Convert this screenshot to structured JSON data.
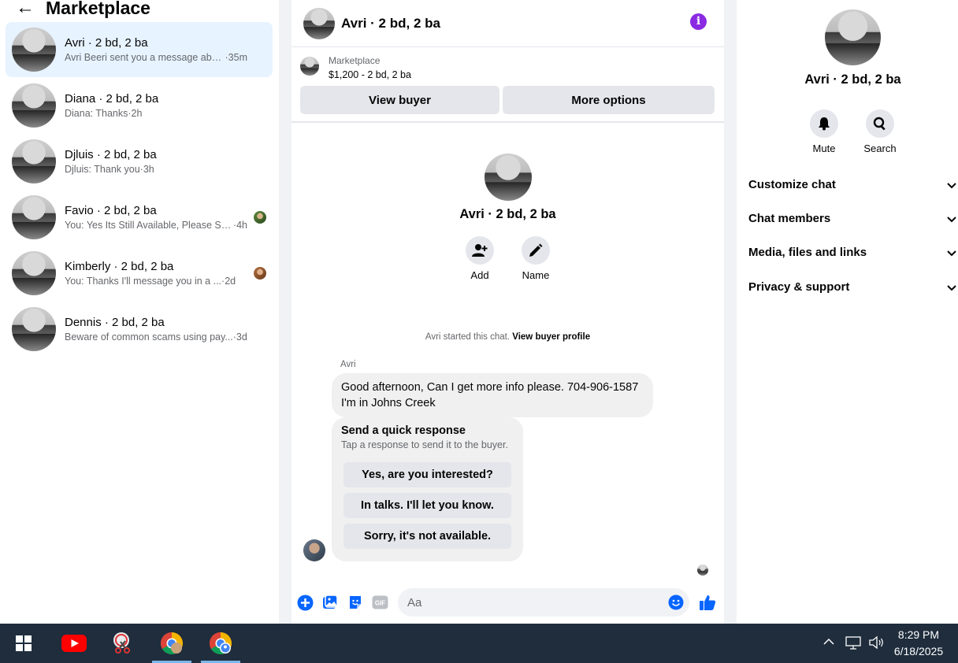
{
  "left": {
    "back_glyph": "←",
    "title": "Marketplace",
    "conversations": [
      {
        "name": "Avri · 2 bd, 2 ba",
        "snippet": "Avri Beeri sent you a message abou...",
        "time": "·35m",
        "active": true
      },
      {
        "name": "Diana · 2 bd, 2 ba",
        "snippet": "Diana: Thanks",
        "time": "·2h"
      },
      {
        "name": "Djluis · 2 bd, 2 ba",
        "snippet": "Djluis: Thank you",
        "time": "·3h"
      },
      {
        "name": "Favio · 2 bd, 2 ba",
        "snippet": "You: Yes Its Still Available, Please Se...",
        "time": "·4h"
      },
      {
        "name": "Kimberly · 2 bd, 2 ba",
        "snippet": "You: Thanks I'll message you in a ...",
        "time": "·2d"
      },
      {
        "name": "Dennis · 2 bd, 2 ba",
        "snippet": "Beware of common scams using pay...",
        "time": "·3d"
      }
    ]
  },
  "chat": {
    "title": "Avri · 2 bd, 2 ba",
    "info_glyph": "i",
    "listing": {
      "source": "Marketplace",
      "price_line": "$1,200 - 2 bd, 2 ba",
      "view_buyer_label": "View buyer",
      "more_options_label": "More options"
    },
    "profile": {
      "name": "Avri · 2 bd, 2 ba",
      "add_label": "Add",
      "name_label": "Name"
    },
    "started_text": "Avri started this chat.",
    "started_link": "View buyer profile",
    "sender": "Avri",
    "message_line1": "Good afternoon, Can I get more info please. 704-906-1587",
    "message_line2": "I'm in Johns Creek",
    "quick_response": {
      "title": "Send a quick response",
      "subtitle": "Tap a response to send it to the buyer.",
      "options": [
        "Yes, are you interested?",
        "In talks. I'll let you know.",
        "Sorry, it's not available."
      ]
    },
    "composer": {
      "placeholder": "Aa",
      "gif_label": "GIF"
    }
  },
  "details": {
    "name": "Avri · 2 bd, 2 ba",
    "mute_label": "Mute",
    "search_label": "Search",
    "sections": [
      "Customize chat",
      "Chat members",
      "Media, files and links",
      "Privacy & support"
    ]
  },
  "taskbar": {
    "time": "8:29 PM",
    "date": "6/18/2025"
  },
  "colors": {
    "accent": "#0866ff",
    "active_bg": "#e7f3ff",
    "info_purple": "#8a2be2",
    "taskbar_bg": "#1f2d3d"
  }
}
